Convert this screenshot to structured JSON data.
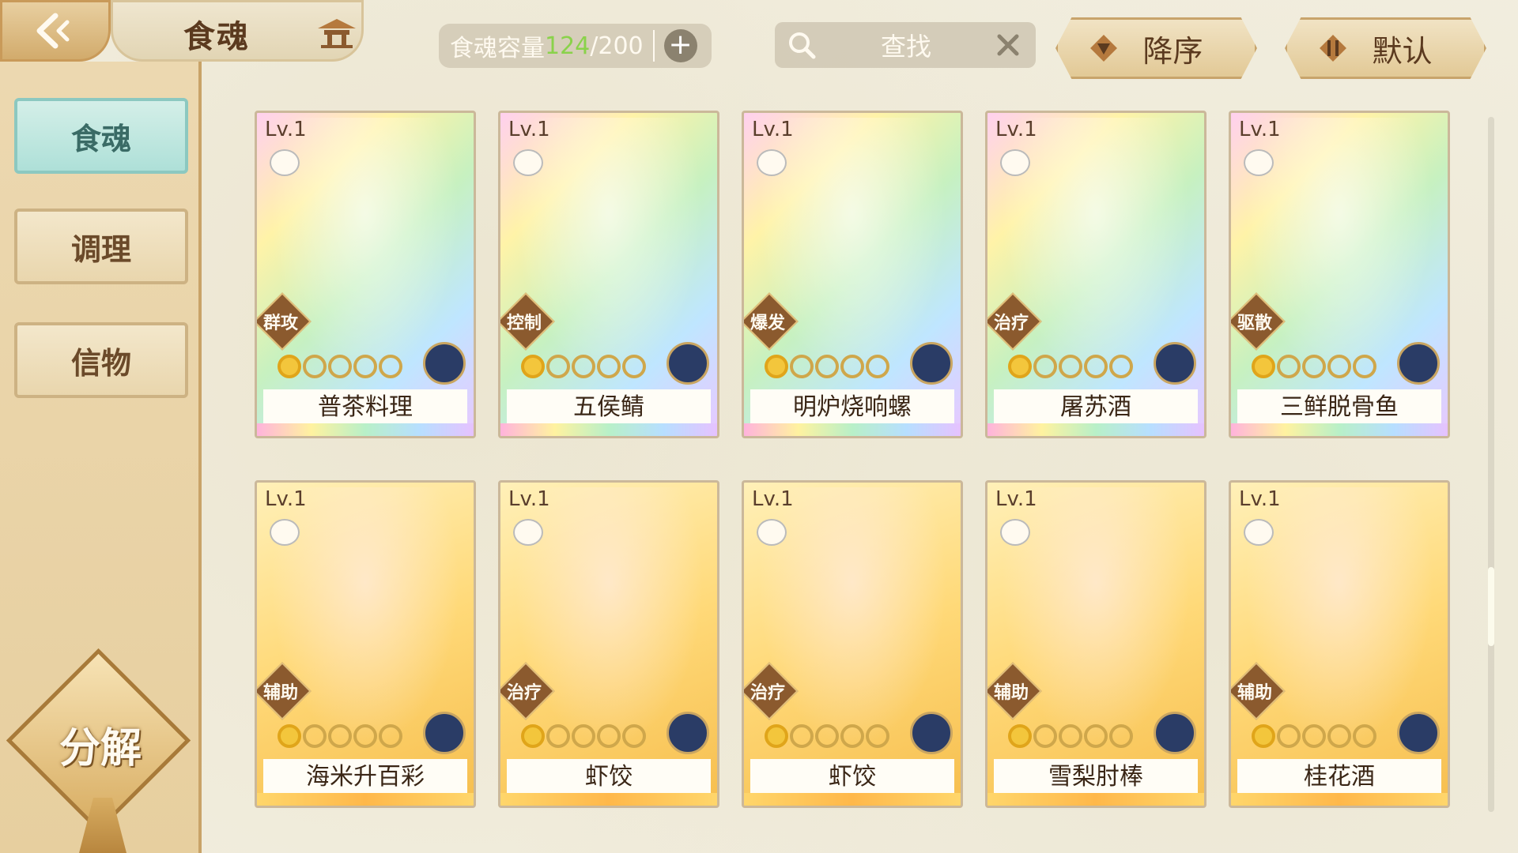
{
  "header": {
    "title": "食魂",
    "capacity_label": "食魂容量",
    "capacity_current": "124",
    "capacity_total": "/200",
    "search_placeholder": "查找",
    "sort_order_label": "降序",
    "sort_mode_label": "默认"
  },
  "sidebar": {
    "items": [
      {
        "label": "食魂",
        "active": true
      },
      {
        "label": "调理",
        "active": false
      },
      {
        "label": "信物",
        "active": false
      }
    ],
    "decompose_label": "分解"
  },
  "cards": [
    {
      "level": "Lv.1",
      "role": "群攻",
      "name": "普茶料理",
      "rarity": "rainbow",
      "stars": 1
    },
    {
      "level": "Lv.1",
      "role": "控制",
      "name": "五侯鲭",
      "rarity": "rainbow",
      "stars": 1
    },
    {
      "level": "Lv.1",
      "role": "爆发",
      "name": "明炉烧响螺",
      "rarity": "rainbow",
      "stars": 1
    },
    {
      "level": "Lv.1",
      "role": "治疗",
      "name": "屠苏酒",
      "rarity": "rainbow",
      "stars": 1
    },
    {
      "level": "Lv.1",
      "role": "驱散",
      "name": "三鲜脱骨鱼",
      "rarity": "rainbow",
      "stars": 1
    },
    {
      "level": "Lv.1",
      "role": "辅助",
      "name": "海米升百彩",
      "rarity": "gold",
      "stars": 1
    },
    {
      "level": "Lv.1",
      "role": "治疗",
      "name": "虾饺",
      "rarity": "gold",
      "stars": 1
    },
    {
      "level": "Lv.1",
      "role": "治疗",
      "name": "虾饺",
      "rarity": "gold",
      "stars": 1
    },
    {
      "level": "Lv.1",
      "role": "辅助",
      "name": "雪梨肘棒",
      "rarity": "gold",
      "stars": 1
    },
    {
      "level": "Lv.1",
      "role": "辅助",
      "name": "桂花酒",
      "rarity": "gold",
      "stars": 1
    }
  ],
  "colors": {
    "accent_gold": "#c9a368",
    "active_tab": "#aee0d8",
    "capacity_green": "#8ad24b"
  }
}
